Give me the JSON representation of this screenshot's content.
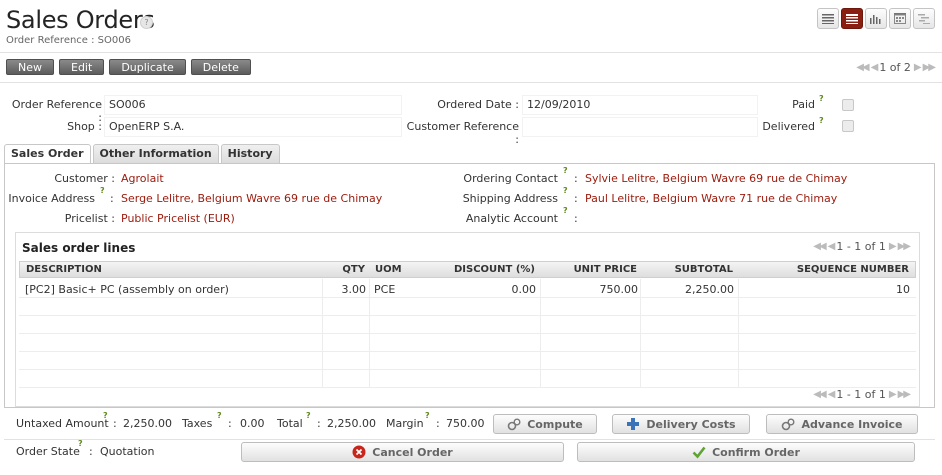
{
  "header": {
    "title": "Sales Orders",
    "help": "?",
    "subtitle": "Order Reference : SO006"
  },
  "view_switcher": [
    "list-view-icon",
    "form-view-icon",
    "graph-view-icon",
    "calendar-view-icon",
    "gantt-view-icon"
  ],
  "toolbar": {
    "new": "New",
    "edit": "Edit",
    "duplicate": "Duplicate",
    "delete": "Delete",
    "pager_text": "1 of 2"
  },
  "form": {
    "order_reference_label": "Order Reference :",
    "order_reference": "SO006",
    "ordered_date_label": "Ordered Date :",
    "ordered_date": "12/09/2010",
    "paid_label": "Paid",
    "shop_label": "Shop :",
    "shop": "OpenERP S.A.",
    "customer_reference_label": "Customer Reference :",
    "customer_reference": "",
    "delivered_label": "Delivered",
    "q": "?"
  },
  "tabs": [
    "Sales Order",
    "Other Information",
    "History"
  ],
  "sales_order": {
    "customer_label": "Customer :",
    "customer": "Agrolait",
    "invoice_address_label": "Invoice Address",
    "invoice_address": "Serge Lelitre, Belgium Wavre 69 rue de Chimay",
    "pricelist_label": "Pricelist :",
    "pricelist": "Public Pricelist (EUR)",
    "ordering_contact_label": "Ordering Contact",
    "ordering_contact": "Sylvie Lelitre, Belgium Wavre 69 rue de Chimay",
    "shipping_address_label": "Shipping Address",
    "shipping_address": "Paul Lelitre, Belgium Wavre 71 rue de Chimay",
    "analytic_account_label": "Analytic Account",
    "colon": ":"
  },
  "lines": {
    "title": "Sales order lines",
    "pager": "1 - 1 of 1",
    "columns": [
      "DESCRIPTION",
      "QTY",
      "UOM",
      "DISCOUNT (%)",
      "UNIT PRICE",
      "SUBTOTAL",
      "SEQUENCE NUMBER"
    ],
    "rows": [
      {
        "description": "[PC2] Basic+ PC (assembly on order)",
        "qty": "3.00",
        "uom": "PCE",
        "discount": "0.00",
        "unit_price": "750.00",
        "subtotal": "2,250.00",
        "sequence": "10"
      }
    ]
  },
  "totals": {
    "untaxed_label": "Untaxed Amount",
    "untaxed": "2,250.00",
    "taxes_label": "Taxes",
    "taxes": "0.00",
    "total_label": "Total",
    "total": "2,250.00",
    "margin_label": "Margin",
    "margin": "750.00",
    "compute": "Compute",
    "delivery_costs": "Delivery Costs",
    "advance_invoice": "Advance Invoice"
  },
  "state": {
    "label": "Order State",
    "value": "Quotation",
    "cancel": "Cancel Order",
    "confirm": "Confirm Order"
  },
  "colors": {
    "brand": "#8a1f11",
    "link": "#9b1a0c",
    "help_green": "#5f8b1c"
  }
}
